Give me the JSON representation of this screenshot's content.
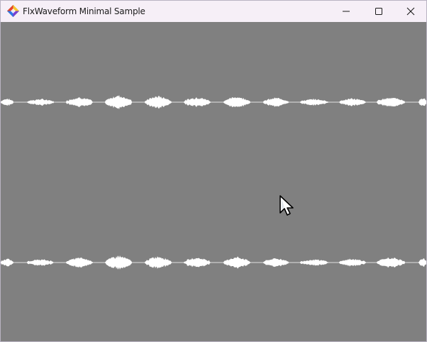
{
  "window": {
    "title": "FlxWaveform Minimal Sample",
    "controls": {
      "minimize": "minimize-icon",
      "maximize": "maximize-icon",
      "close": "close-icon"
    }
  },
  "canvas": {
    "background": "#808080",
    "waveform_color": "#ffffff",
    "channels": [
      "left",
      "right"
    ]
  }
}
